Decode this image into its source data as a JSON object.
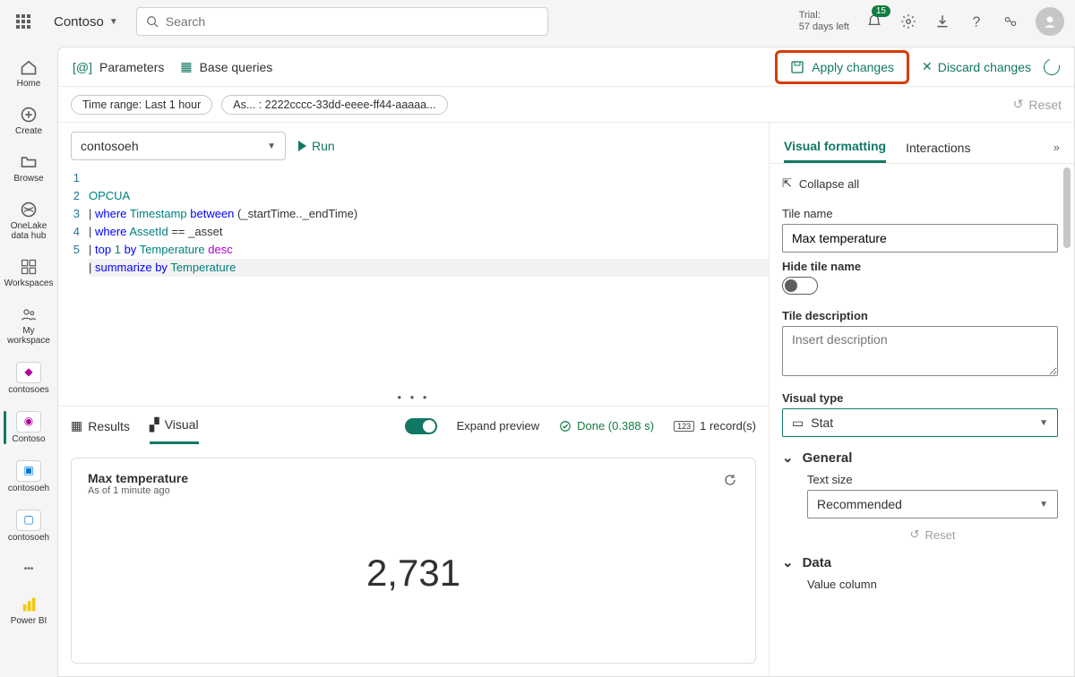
{
  "top": {
    "org": "Contoso",
    "search_placeholder": "Search",
    "trial_l1": "Trial:",
    "trial_l2": "57 days left",
    "notif_count": "15"
  },
  "nav": {
    "home": "Home",
    "create": "Create",
    "browse": "Browse",
    "onelake": "OneLake data hub",
    "workspaces": "Workspaces",
    "my_ws": "My workspace",
    "ws1": "contosoes",
    "ws2": "Contoso",
    "ws3": "contosoeh",
    "ws4": "contosoeh",
    "powerbi": "Power BI"
  },
  "cmd": {
    "parameters": "Parameters",
    "base_queries": "Base queries",
    "apply": "Apply changes",
    "discard": "Discard changes"
  },
  "filters": {
    "time": "Time range: Last 1 hour",
    "asset": "As... : 2222cccc-33dd-eeee-ff44-aaaaa...",
    "reset": "Reset"
  },
  "editor": {
    "datasource": "contosoeh",
    "run": "Run",
    "lines": [
      "1",
      "2",
      "3",
      "4",
      "5"
    ],
    "code": {
      "l1": "OPCUA",
      "l2_a": "where",
      "l2_b": "Timestamp",
      "l2_c": "between",
      "l2_d": "(_startTime.._endTime)",
      "l3_a": "where",
      "l3_b": "AssetId",
      "l3_c": "==",
      "l3_d": "_asset",
      "l4_a": "top",
      "l4_b": "1",
      "l4_c": "by",
      "l4_d": "Temperature",
      "l4_e": "desc",
      "l5_a": "summarize",
      "l5_b": "by",
      "l5_c": "Temperature"
    }
  },
  "results": {
    "tab_results": "Results",
    "tab_visual": "Visual",
    "expand": "Expand preview",
    "done": "Done (0.388 s)",
    "records": "1 record(s)"
  },
  "tile": {
    "title": "Max temperature",
    "sub": "As of 1 minute ago",
    "value": "2,731"
  },
  "panel": {
    "tab_vf": "Visual formatting",
    "tab_int": "Interactions",
    "collapse": "Collapse all",
    "tile_name_lbl": "Tile name",
    "tile_name_val": "Max temperature",
    "hide_lbl": "Hide tile name",
    "desc_lbl": "Tile description",
    "desc_ph": "Insert description",
    "vt_lbl": "Visual type",
    "vt_val": "Stat",
    "general": "General",
    "text_size_lbl": "Text size",
    "text_size_val": "Recommended",
    "reset": "Reset",
    "data": "Data",
    "value_col": "Value column"
  }
}
